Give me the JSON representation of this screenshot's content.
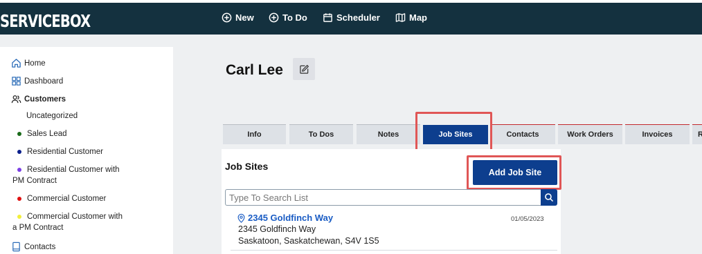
{
  "app": {
    "logo": "SERVICEBOX"
  },
  "topnav": {
    "new_label": "New",
    "todo_label": "To Do",
    "scheduler_label": "Scheduler",
    "map_label": "Map"
  },
  "sidebar": {
    "home": "Home",
    "dashboard": "Dashboard",
    "customers": "Customers",
    "uncategorized": "Uncategorized",
    "sales_lead": "Sales Lead",
    "residential": "Residential Customer",
    "residential_pm_1": "Residential Customer with",
    "residential_pm_2": "PM Contract",
    "commercial": "Commercial Customer",
    "commercial_pm_1": "Commercial Customer with",
    "commercial_pm_2": "a PM Contract",
    "contacts": "Contacts"
  },
  "colors": {
    "sales_lead": "#1a6b1a",
    "residential": "#0b1f8c",
    "residential_pm": "#7b3fe4",
    "commercial": "#e01010",
    "commercial_pm": "#f2ef3a"
  },
  "customer": {
    "name": "Carl Lee"
  },
  "tabs": {
    "info": "Info",
    "todos": "To Dos",
    "notes": "Notes",
    "job_sites": "Job Sites",
    "contacts": "Contacts",
    "work_orders": "Work Orders",
    "invoices": "Invoices",
    "more": "R"
  },
  "job_sites": {
    "title": "Job Sites",
    "add_label": "Add Job Site",
    "search_placeholder": "Type To Search List",
    "items": [
      {
        "name": "2345 Goldfinch Way",
        "date": "01/05/2023",
        "address_line1": "2345 Goldfinch Way",
        "address_line2": "Saskatoon, Saskatchewan, S4V 1S5"
      }
    ]
  }
}
